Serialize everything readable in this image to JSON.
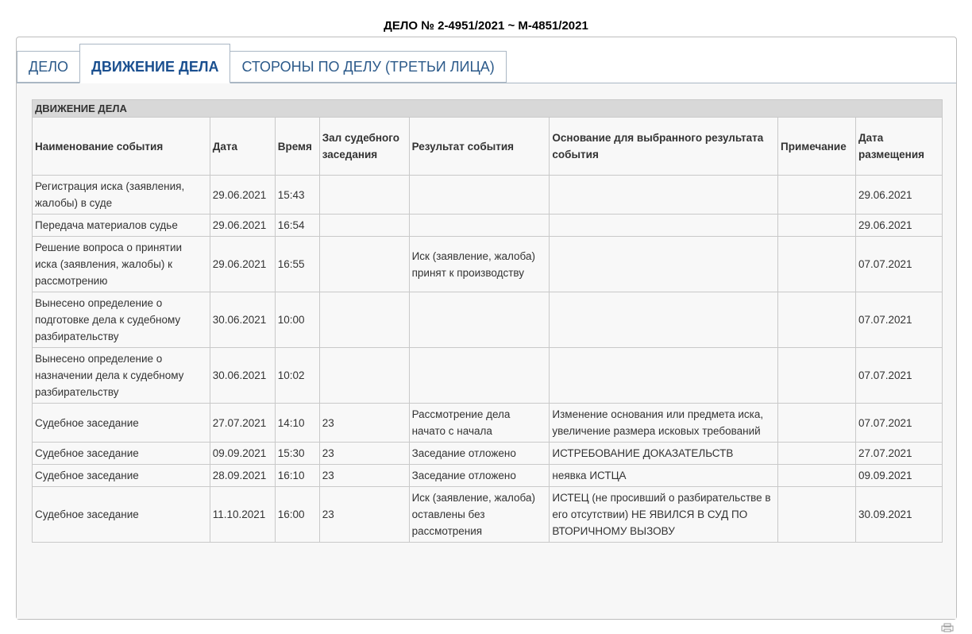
{
  "case_title": "ДЕЛО № 2-4951/2021 ~ М-4851/2021",
  "tabs": [
    {
      "label": "ДЕЛО"
    },
    {
      "label": "ДВИЖЕНИЕ ДЕЛА"
    },
    {
      "label": "СТОРОНЫ ПО ДЕЛУ (ТРЕТЬИ ЛИЦА)"
    }
  ],
  "table": {
    "section_title": "ДВИЖЕНИЕ ДЕЛА",
    "columns": [
      "Наименование события",
      "Дата",
      "Время",
      "Зал судебного заседания",
      "Результат события",
      "Основание для выбранного результата события",
      "Примечание",
      "Дата размещения"
    ],
    "rows": [
      [
        "Регистрация иска (заявления, жалобы) в суде",
        "29.06.2021",
        "15:43",
        "",
        "",
        "",
        "",
        "29.06.2021"
      ],
      [
        "Передача материалов судье",
        "29.06.2021",
        "16:54",
        "",
        "",
        "",
        "",
        "29.06.2021"
      ],
      [
        "Решение вопроса о принятии иска (заявления, жалобы) к рассмотрению",
        "29.06.2021",
        "16:55",
        "",
        "Иск (заявление, жалоба) принят к производству",
        "",
        "",
        "07.07.2021"
      ],
      [
        "Вынесено определение о подготовке дела к судебному разбирательству",
        "30.06.2021",
        "10:00",
        "",
        "",
        "",
        "",
        "07.07.2021"
      ],
      [
        "Вынесено определение о назначении дела к судебному разбирательству",
        "30.06.2021",
        "10:02",
        "",
        "",
        "",
        "",
        "07.07.2021"
      ],
      [
        "Судебное заседание",
        "27.07.2021",
        "14:10",
        "23",
        "Рассмотрение дела начато с начала",
        "Изменение основания или предмета иска, увеличение размера исковых требований",
        "",
        "07.07.2021"
      ],
      [
        "Судебное заседание",
        "09.09.2021",
        "15:30",
        "23",
        "Заседание отложено",
        "ИСТРЕБОВАНИЕ ДОКАЗАТЕЛЬСТВ",
        "",
        "27.07.2021"
      ],
      [
        "Судебное заседание",
        "28.09.2021",
        "16:10",
        "23",
        "Заседание отложено",
        "неявка ИСТЦА",
        "",
        "09.09.2021"
      ],
      [
        "Судебное заседание",
        "11.10.2021",
        "16:00",
        "23",
        "Иск (заявление, жалоба) оставлены без рассмотрения",
        "ИСТЕЦ (не просивший о разбирательстве в его отсутствии) НЕ ЯВИЛСЯ В СУД ПО ВТОРИЧНОМУ ВЫЗОВУ",
        "",
        "30.09.2021"
      ]
    ]
  },
  "icons": {
    "footer": "print-icon"
  }
}
